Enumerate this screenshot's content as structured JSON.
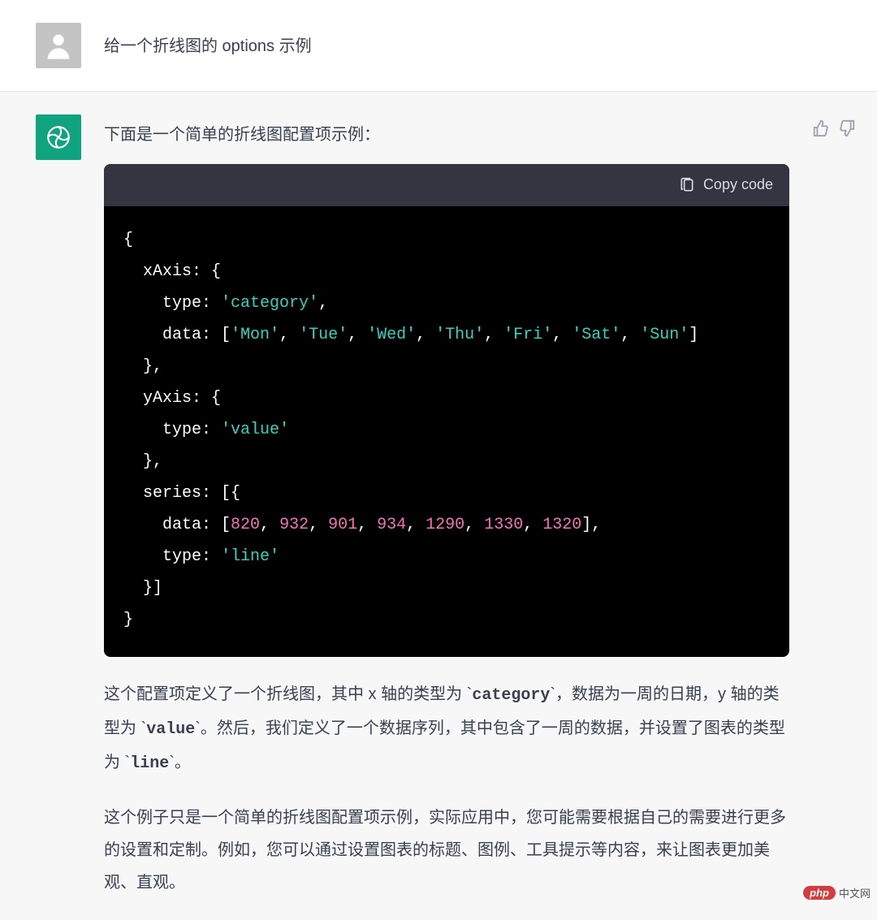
{
  "user_message": "给一个折线图的 options  示例",
  "assistant_intro": "下面是一个简单的折线图配置项示例：",
  "copy_label": "Copy code",
  "code_tokens": [
    [
      [
        "pun",
        "{"
      ]
    ],
    [
      [
        "pun",
        "  xAxis: {"
      ]
    ],
    [
      [
        "pun",
        "    type: "
      ],
      [
        "str",
        "'category'"
      ],
      [
        "pun",
        ","
      ]
    ],
    [
      [
        "pun",
        "    data: ["
      ],
      [
        "str",
        "'Mon'"
      ],
      [
        "pun",
        ", "
      ],
      [
        "str",
        "'Tue'"
      ],
      [
        "pun",
        ", "
      ],
      [
        "str",
        "'Wed'"
      ],
      [
        "pun",
        ", "
      ],
      [
        "str",
        "'Thu'"
      ],
      [
        "pun",
        ", "
      ],
      [
        "str",
        "'Fri'"
      ],
      [
        "pun",
        ", "
      ],
      [
        "str",
        "'Sat'"
      ],
      [
        "pun",
        ", "
      ],
      [
        "str",
        "'Sun'"
      ],
      [
        "pun",
        "]"
      ]
    ],
    [
      [
        "pun",
        "  },"
      ]
    ],
    [
      [
        "pun",
        "  yAxis: {"
      ]
    ],
    [
      [
        "pun",
        "    type: "
      ],
      [
        "str",
        "'value'"
      ]
    ],
    [
      [
        "pun",
        "  },"
      ]
    ],
    [
      [
        "pun",
        "  series: [{"
      ]
    ],
    [
      [
        "pun",
        "    data: ["
      ],
      [
        "num",
        "820"
      ],
      [
        "pun",
        ", "
      ],
      [
        "num",
        "932"
      ],
      [
        "pun",
        ", "
      ],
      [
        "num",
        "901"
      ],
      [
        "pun",
        ", "
      ],
      [
        "num",
        "934"
      ],
      [
        "pun",
        ", "
      ],
      [
        "num",
        "1290"
      ],
      [
        "pun",
        ", "
      ],
      [
        "num",
        "1330"
      ],
      [
        "pun",
        ", "
      ],
      [
        "num",
        "1320"
      ],
      [
        "pun",
        "],"
      ]
    ],
    [
      [
        "pun",
        "    type: "
      ],
      [
        "str",
        "'line'"
      ]
    ],
    [
      [
        "pun",
        "  }]"
      ]
    ],
    [
      [
        "pun",
        "}"
      ]
    ]
  ],
  "para1_parts": [
    {
      "t": "text",
      "v": "这个配置项定义了一个折线图，其中 x 轴的类型为 `"
    },
    {
      "t": "mono",
      "v": "category"
    },
    {
      "t": "text",
      "v": "`，数据为一周的日期，y 轴的类型为 `"
    },
    {
      "t": "mono",
      "v": "value"
    },
    {
      "t": "text",
      "v": "`。然后，我们定义了一个数据序列，其中包含了一周的数据，并设置了图表的类型为 `"
    },
    {
      "t": "mono",
      "v": "line"
    },
    {
      "t": "text",
      "v": "`。"
    }
  ],
  "para2": "这个例子只是一个简单的折线图配置项示例，实际应用中，您可能需要根据自己的需要进行更多的设置和定制。例如，您可以通过设置图表的标题、图例、工具提示等内容，来让图表更加美观、直观。",
  "watermark": {
    "badge": "php",
    "text": "中文网"
  },
  "chart_data": {
    "type": "line",
    "categories": [
      "Mon",
      "Tue",
      "Wed",
      "Thu",
      "Fri",
      "Sat",
      "Sun"
    ],
    "values": [
      820,
      932,
      901,
      934,
      1290,
      1330,
      1320
    ],
    "xaxis_type": "category",
    "yaxis_type": "value"
  }
}
